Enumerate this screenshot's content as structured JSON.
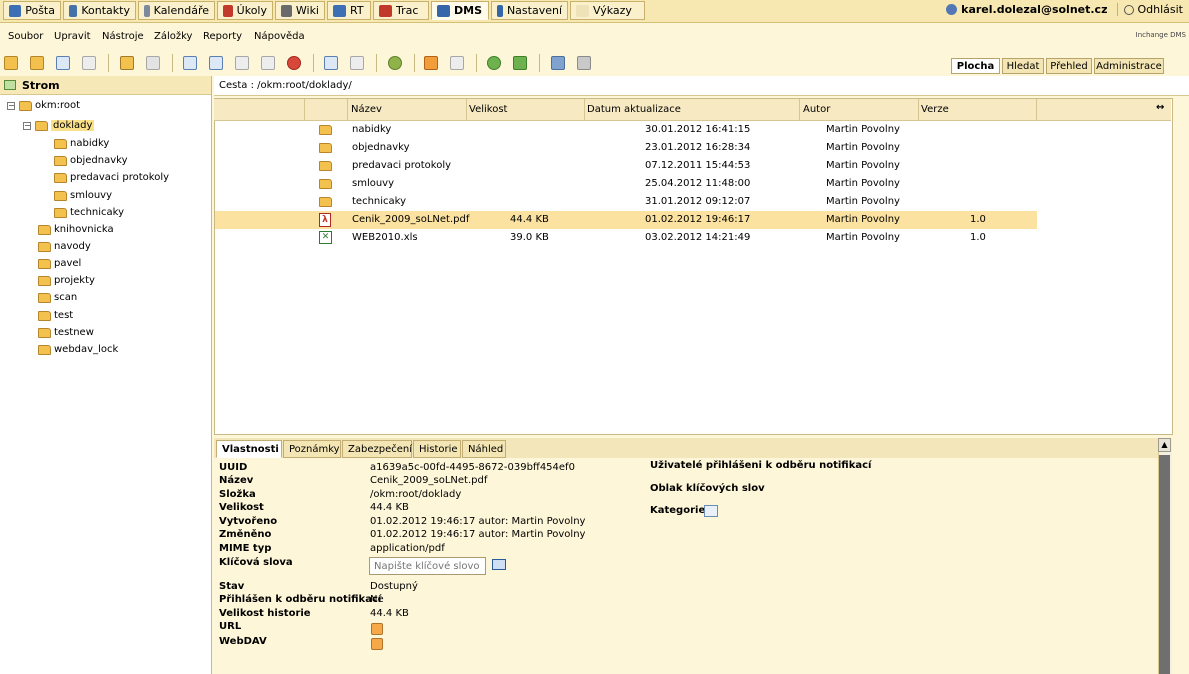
{
  "topnav": {
    "tabs": [
      {
        "label": "Pošta",
        "color": "#3C6FB4"
      },
      {
        "label": "Kontakty",
        "color": "#4472A8"
      },
      {
        "label": "Kalendáře",
        "color": "#7D8A9C"
      },
      {
        "label": "Úkoly",
        "color": "#C23A2B"
      },
      {
        "label": "Wiki",
        "color": "#6A6A6A"
      },
      {
        "label": "RT",
        "color": "#3C6FB4"
      },
      {
        "label": "Trac",
        "color": "#C0392B"
      },
      {
        "label": "DMS",
        "color": "#3566AA"
      },
      {
        "label": "Nastavení",
        "color": "#3566AA"
      },
      {
        "label": "Výkazy",
        "color": "#EDE2B8"
      }
    ],
    "user_email": "karel.dolezal@solnet.cz",
    "logout_label": "Odhlásit"
  },
  "menubar": {
    "items": [
      "Soubor",
      "Upravit",
      "Nástroje",
      "Záložky",
      "Reporty",
      "Nápověda"
    ],
    "brand": "Inchange DMS"
  },
  "right_tabs": [
    "Plocha",
    "Hledat",
    "Přehled",
    "Administrace"
  ],
  "tree": {
    "header": "Strom",
    "root": "okm:root",
    "selected": "doklady",
    "children_of_selected": [
      "nabidky",
      "objednavky",
      "predavaci protokoly",
      "smlouvy",
      "technicaky"
    ],
    "siblings": [
      "knihovnicka",
      "navody",
      "pavel",
      "projekty",
      "scan",
      "test",
      "testnew",
      "webdav_lock"
    ]
  },
  "path": {
    "label": "Cesta : /okm:root/doklady/"
  },
  "grid": {
    "columns": [
      "Název",
      "Velikost",
      "Datum aktualizace",
      "Autor",
      "Verze"
    ],
    "rows": [
      {
        "type": "folder",
        "name": "nabidky",
        "size": "",
        "date": "30.01.2012 16:41:15",
        "author": "Martin Povolny",
        "version": ""
      },
      {
        "type": "folder",
        "name": "objednavky",
        "size": "",
        "date": "23.01.2012 16:28:34",
        "author": "Martin Povolny",
        "version": ""
      },
      {
        "type": "folder",
        "name": "predavaci protokoly",
        "size": "",
        "date": "07.12.2011 15:44:53",
        "author": "Martin Povolny",
        "version": ""
      },
      {
        "type": "folder",
        "name": "smlouvy",
        "size": "",
        "date": "25.04.2012 11:48:00",
        "author": "Martin Povolny",
        "version": ""
      },
      {
        "type": "folder-locked",
        "name": "technicaky",
        "size": "",
        "date": "31.01.2012 09:12:07",
        "author": "Martin Povolny",
        "version": ""
      },
      {
        "type": "pdf",
        "name": "Cenik_2009_soLNet.pdf",
        "size": "44.4 KB",
        "date": "01.02.2012 19:46:17",
        "author": "Martin Povolny",
        "version": "1.0"
      },
      {
        "type": "xls",
        "name": "WEB2010.xls",
        "size": "39.0 KB",
        "date": "03.02.2012 14:21:49",
        "author": "Martin Povolny",
        "version": "1.0"
      }
    ],
    "selected_index": 5
  },
  "bottom_tabs": [
    "Vlastnosti",
    "Poznámky",
    "Zabezpečení",
    "Historie",
    "Náhled"
  ],
  "properties": {
    "rows": [
      {
        "label": "UUID",
        "value": "a1639a5c-00fd-4495-8672-039bff454ef0"
      },
      {
        "label": "Název",
        "value": "Cenik_2009_soLNet.pdf"
      },
      {
        "label": "Složka",
        "value": "/okm:root/doklady"
      },
      {
        "label": "Velikost",
        "value": "44.4 KB"
      },
      {
        "label": "Vytvořeno",
        "value": "01.02.2012 19:46:17 autor: Martin Povolny"
      },
      {
        "label": "Změněno",
        "value": "01.02.2012 19:46:17 autor: Martin Povolny"
      },
      {
        "label": "MIME typ",
        "value": "application/pdf"
      },
      {
        "label": "Klíčová slova",
        "value": ""
      },
      {
        "label": "Stav",
        "value": "Dostupný"
      },
      {
        "label": "Přihlášen k odběru notifikací",
        "value": "Ne"
      },
      {
        "label": "Velikost historie",
        "value": "44.4 KB"
      },
      {
        "label": "URL",
        "value": ""
      },
      {
        "label": "WebDAV",
        "value": ""
      }
    ],
    "keyword_placeholder": "Napište klíčové slovo",
    "right_titles": [
      "Uživatelé přihlášeni k odběru notifikací",
      "Oblak klíčových slov",
      "Kategorie"
    ]
  }
}
